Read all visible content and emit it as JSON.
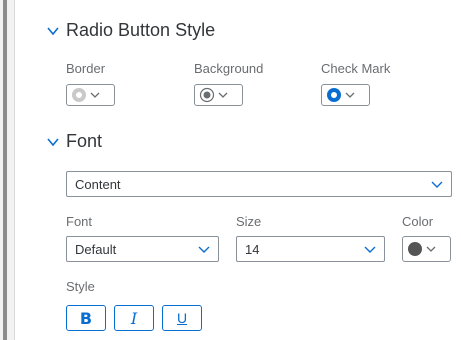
{
  "radio_section": {
    "title": "Radio Button Style",
    "border_label": "Border",
    "background_label": "Background",
    "checkmark_label": "Check Mark",
    "colors": {
      "border_icon": "#c2c2c2",
      "background_icon_ring": "#6a6d70",
      "checkmark_icon": "#0a6ed1"
    }
  },
  "font_section": {
    "title": "Font",
    "target_select": {
      "value": "Content"
    },
    "font_label": "Font",
    "font_select": {
      "value": "Default"
    },
    "size_label": "Size",
    "size_select": {
      "value": "14"
    },
    "color_label": "Color",
    "color_value": "#555555",
    "style_label": "Style",
    "style_buttons": {
      "bold": "B",
      "italic": "I",
      "underline": "U"
    }
  },
  "accent": "#0a6ed1"
}
